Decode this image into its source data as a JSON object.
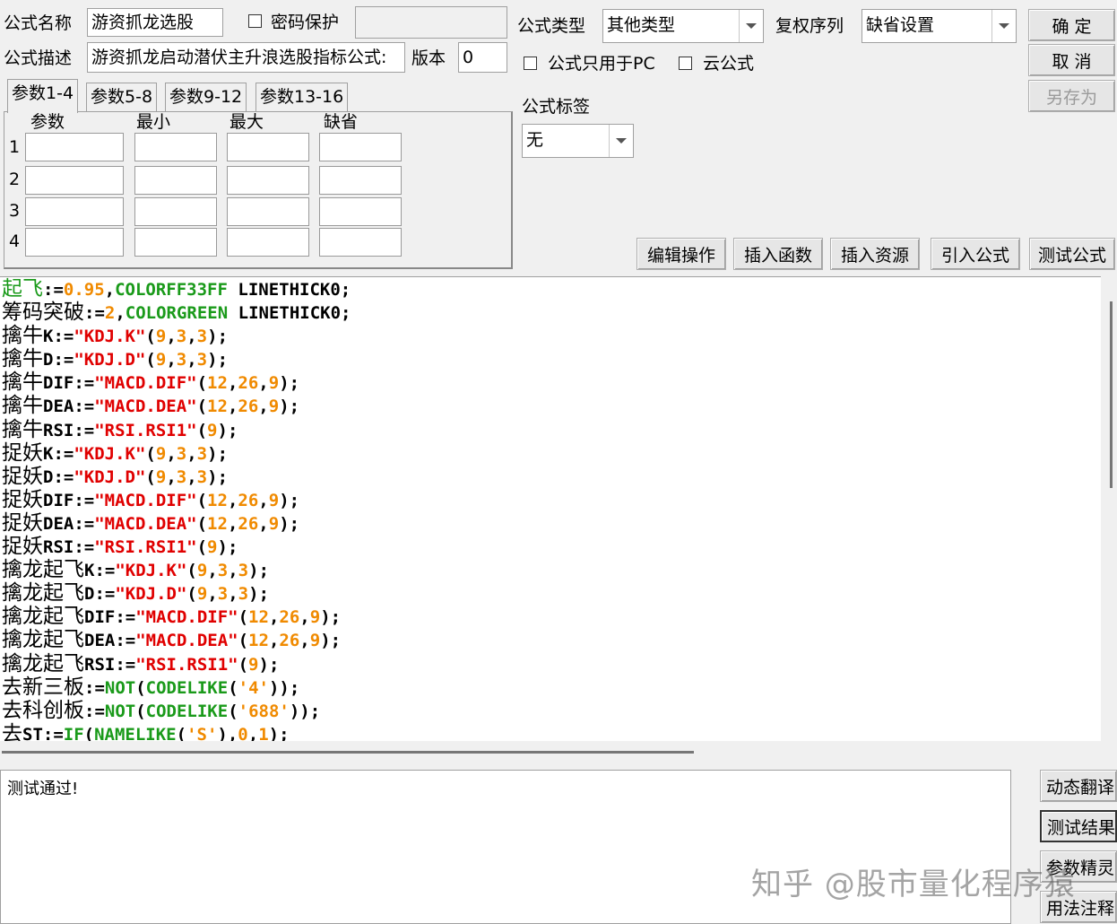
{
  "header": {
    "name_label": "公式名称",
    "name_value": "游资抓龙选股",
    "pwd_label": "密码保护",
    "desc_label": "公式描述",
    "desc_value": "游资抓龙启动潜伏主升浪选股指标公式:",
    "version_label": "版本",
    "version_value": "0",
    "type_label": "公式类型",
    "type_value": "其他类型",
    "fuquan_label": "复权序列",
    "fuquan_value": "缺省设置",
    "pc_only_label": "公式只用于PC",
    "cloud_label": "云公式",
    "tag_label": "公式标签",
    "tag_value": "无"
  },
  "buttons": {
    "ok": "确  定",
    "cancel": "取  消",
    "save_as": "另存为",
    "edit_ops": "编辑操作",
    "insert_func": "插入函数",
    "insert_res": "插入资源",
    "import_formula": "引入公式",
    "test_formula": "测试公式",
    "dyn_translate": "动态翻译",
    "test_result": "测试结果",
    "param_wizard": "参数精灵",
    "usage_notes": "用法注释"
  },
  "params": {
    "tabs": [
      "参数1-4",
      "参数5-8",
      "参数9-12",
      "参数13-16"
    ],
    "headers": [
      "参数",
      "最小",
      "最大",
      "缺省"
    ],
    "rows": [
      "1",
      "2",
      "3",
      "4"
    ]
  },
  "colors": {
    "green": "#1a9a1a",
    "orange": "#f08a00",
    "red": "#e00000",
    "cyan": "#008a8a"
  },
  "code_lines": [
    [
      {
        "t": "起飞",
        "c": "green",
        "cn": true
      },
      {
        "t": ":=",
        "c": "black"
      },
      {
        "t": "0.95",
        "c": "orange"
      },
      {
        "t": ",",
        "c": "black"
      },
      {
        "t": "COLORFF33FF",
        "c": "green"
      },
      {
        "t": " LINETHICK0;",
        "c": "black"
      }
    ],
    [
      {
        "t": "筹码突破",
        "c": "black",
        "cn": true
      },
      {
        "t": ":=",
        "c": "black"
      },
      {
        "t": "2",
        "c": "orange"
      },
      {
        "t": ",",
        "c": "black"
      },
      {
        "t": "COLORGREEN",
        "c": "green"
      },
      {
        "t": " LINETHICK0;",
        "c": "black"
      }
    ],
    [
      {
        "t": "擒牛",
        "c": "black",
        "cn": true
      },
      {
        "t": "K:=",
        "c": "black"
      },
      {
        "t": "\"KDJ.K\"",
        "c": "red"
      },
      {
        "t": "(",
        "c": "black"
      },
      {
        "t": "9",
        "c": "orange"
      },
      {
        "t": ",",
        "c": "black"
      },
      {
        "t": "3",
        "c": "orange"
      },
      {
        "t": ",",
        "c": "black"
      },
      {
        "t": "3",
        "c": "orange"
      },
      {
        "t": ");",
        "c": "black"
      }
    ],
    [
      {
        "t": "擒牛",
        "c": "black",
        "cn": true
      },
      {
        "t": "D:=",
        "c": "black"
      },
      {
        "t": "\"KDJ.D\"",
        "c": "red"
      },
      {
        "t": "(",
        "c": "black"
      },
      {
        "t": "9",
        "c": "orange"
      },
      {
        "t": ",",
        "c": "black"
      },
      {
        "t": "3",
        "c": "orange"
      },
      {
        "t": ",",
        "c": "black"
      },
      {
        "t": "3",
        "c": "orange"
      },
      {
        "t": ");",
        "c": "black"
      }
    ],
    [
      {
        "t": "擒牛",
        "c": "black",
        "cn": true
      },
      {
        "t": "DIF:=",
        "c": "black"
      },
      {
        "t": "\"MACD.DIF\"",
        "c": "red"
      },
      {
        "t": "(",
        "c": "black"
      },
      {
        "t": "12",
        "c": "orange"
      },
      {
        "t": ",",
        "c": "black"
      },
      {
        "t": "26",
        "c": "orange"
      },
      {
        "t": ",",
        "c": "black"
      },
      {
        "t": "9",
        "c": "orange"
      },
      {
        "t": ");",
        "c": "black"
      }
    ],
    [
      {
        "t": "擒牛",
        "c": "black",
        "cn": true
      },
      {
        "t": "DEA:=",
        "c": "black"
      },
      {
        "t": "\"MACD.DEA\"",
        "c": "red"
      },
      {
        "t": "(",
        "c": "black"
      },
      {
        "t": "12",
        "c": "orange"
      },
      {
        "t": ",",
        "c": "black"
      },
      {
        "t": "26",
        "c": "orange"
      },
      {
        "t": ",",
        "c": "black"
      },
      {
        "t": "9",
        "c": "orange"
      },
      {
        "t": ");",
        "c": "black"
      }
    ],
    [
      {
        "t": "擒牛",
        "c": "black",
        "cn": true
      },
      {
        "t": "RSI:=",
        "c": "black"
      },
      {
        "t": "\"RSI.RSI1\"",
        "c": "red"
      },
      {
        "t": "(",
        "c": "black"
      },
      {
        "t": "9",
        "c": "orange"
      },
      {
        "t": ");",
        "c": "black"
      }
    ],
    [
      {
        "t": "捉妖",
        "c": "black",
        "cn": true
      },
      {
        "t": "K:=",
        "c": "black"
      },
      {
        "t": "\"KDJ.K\"",
        "c": "red"
      },
      {
        "t": "(",
        "c": "black"
      },
      {
        "t": "9",
        "c": "orange"
      },
      {
        "t": ",",
        "c": "black"
      },
      {
        "t": "3",
        "c": "orange"
      },
      {
        "t": ",",
        "c": "black"
      },
      {
        "t": "3",
        "c": "orange"
      },
      {
        "t": ");",
        "c": "black"
      }
    ],
    [
      {
        "t": "捉妖",
        "c": "black",
        "cn": true
      },
      {
        "t": "D:=",
        "c": "black"
      },
      {
        "t": "\"KDJ.D\"",
        "c": "red"
      },
      {
        "t": "(",
        "c": "black"
      },
      {
        "t": "9",
        "c": "orange"
      },
      {
        "t": ",",
        "c": "black"
      },
      {
        "t": "3",
        "c": "orange"
      },
      {
        "t": ",",
        "c": "black"
      },
      {
        "t": "3",
        "c": "orange"
      },
      {
        "t": ");",
        "c": "black"
      }
    ],
    [
      {
        "t": "捉妖",
        "c": "black",
        "cn": true
      },
      {
        "t": "DIF:=",
        "c": "black"
      },
      {
        "t": "\"MACD.DIF\"",
        "c": "red"
      },
      {
        "t": "(",
        "c": "black"
      },
      {
        "t": "12",
        "c": "orange"
      },
      {
        "t": ",",
        "c": "black"
      },
      {
        "t": "26",
        "c": "orange"
      },
      {
        "t": ",",
        "c": "black"
      },
      {
        "t": "9",
        "c": "orange"
      },
      {
        "t": ");",
        "c": "black"
      }
    ],
    [
      {
        "t": "捉妖",
        "c": "black",
        "cn": true
      },
      {
        "t": "DEA:=",
        "c": "black"
      },
      {
        "t": "\"MACD.DEA\"",
        "c": "red"
      },
      {
        "t": "(",
        "c": "black"
      },
      {
        "t": "12",
        "c": "orange"
      },
      {
        "t": ",",
        "c": "black"
      },
      {
        "t": "26",
        "c": "orange"
      },
      {
        "t": ",",
        "c": "black"
      },
      {
        "t": "9",
        "c": "orange"
      },
      {
        "t": ");",
        "c": "black"
      }
    ],
    [
      {
        "t": "捉妖",
        "c": "black",
        "cn": true
      },
      {
        "t": "RSI:=",
        "c": "black"
      },
      {
        "t": "\"RSI.RSI1\"",
        "c": "red"
      },
      {
        "t": "(",
        "c": "black"
      },
      {
        "t": "9",
        "c": "orange"
      },
      {
        "t": ");",
        "c": "black"
      }
    ],
    [
      {
        "t": "擒龙起飞",
        "c": "black",
        "cn": true
      },
      {
        "t": "K:=",
        "c": "black"
      },
      {
        "t": "\"KDJ.K\"",
        "c": "red"
      },
      {
        "t": "(",
        "c": "black"
      },
      {
        "t": "9",
        "c": "orange"
      },
      {
        "t": ",",
        "c": "black"
      },
      {
        "t": "3",
        "c": "orange"
      },
      {
        "t": ",",
        "c": "black"
      },
      {
        "t": "3",
        "c": "orange"
      },
      {
        "t": ");",
        "c": "black"
      }
    ],
    [
      {
        "t": "擒龙起飞",
        "c": "black",
        "cn": true
      },
      {
        "t": "D:=",
        "c": "black"
      },
      {
        "t": "\"KDJ.D\"",
        "c": "red"
      },
      {
        "t": "(",
        "c": "black"
      },
      {
        "t": "9",
        "c": "orange"
      },
      {
        "t": ",",
        "c": "black"
      },
      {
        "t": "3",
        "c": "orange"
      },
      {
        "t": ",",
        "c": "black"
      },
      {
        "t": "3",
        "c": "orange"
      },
      {
        "t": ");",
        "c": "black"
      }
    ],
    [
      {
        "t": "擒龙起飞",
        "c": "black",
        "cn": true
      },
      {
        "t": "DIF:=",
        "c": "black"
      },
      {
        "t": "\"MACD.DIF\"",
        "c": "red"
      },
      {
        "t": "(",
        "c": "black"
      },
      {
        "t": "12",
        "c": "orange"
      },
      {
        "t": ",",
        "c": "black"
      },
      {
        "t": "26",
        "c": "orange"
      },
      {
        "t": ",",
        "c": "black"
      },
      {
        "t": "9",
        "c": "orange"
      },
      {
        "t": ");",
        "c": "black"
      }
    ],
    [
      {
        "t": "擒龙起飞",
        "c": "black",
        "cn": true
      },
      {
        "t": "DEA:=",
        "c": "black"
      },
      {
        "t": "\"MACD.DEA\"",
        "c": "red"
      },
      {
        "t": "(",
        "c": "black"
      },
      {
        "t": "12",
        "c": "orange"
      },
      {
        "t": ",",
        "c": "black"
      },
      {
        "t": "26",
        "c": "orange"
      },
      {
        "t": ",",
        "c": "black"
      },
      {
        "t": "9",
        "c": "orange"
      },
      {
        "t": ");",
        "c": "black"
      }
    ],
    [
      {
        "t": "擒龙起飞",
        "c": "black",
        "cn": true
      },
      {
        "t": "RSI:=",
        "c": "black"
      },
      {
        "t": "\"RSI.RSI1\"",
        "c": "red"
      },
      {
        "t": "(",
        "c": "black"
      },
      {
        "t": "9",
        "c": "orange"
      },
      {
        "t": ");",
        "c": "black"
      }
    ],
    [
      {
        "t": "去新三板",
        "c": "black",
        "cn": true
      },
      {
        "t": ":=",
        "c": "black"
      },
      {
        "t": "NOT",
        "c": "green"
      },
      {
        "t": "(",
        "c": "black"
      },
      {
        "t": "CODELIKE",
        "c": "green"
      },
      {
        "t": "(",
        "c": "black"
      },
      {
        "t": "'4'",
        "c": "orange"
      },
      {
        "t": "));",
        "c": "black"
      }
    ],
    [
      {
        "t": "去科创板",
        "c": "black",
        "cn": true
      },
      {
        "t": ":=",
        "c": "black"
      },
      {
        "t": "NOT",
        "c": "green"
      },
      {
        "t": "(",
        "c": "black"
      },
      {
        "t": "CODELIKE",
        "c": "green"
      },
      {
        "t": "(",
        "c": "black"
      },
      {
        "t": "'688'",
        "c": "orange"
      },
      {
        "t": "));",
        "c": "black"
      }
    ],
    [
      {
        "t": "去",
        "c": "black",
        "cn": true
      },
      {
        "t": "ST:=",
        "c": "black"
      },
      {
        "t": "IF",
        "c": "green"
      },
      {
        "t": "(",
        "c": "black"
      },
      {
        "t": "NAMELIKE",
        "c": "green"
      },
      {
        "t": "(",
        "c": "black"
      },
      {
        "t": "'S'",
        "c": "orange"
      },
      {
        "t": "),",
        "c": "black"
      },
      {
        "t": "0",
        "c": "orange"
      },
      {
        "t": ",",
        "c": "black"
      },
      {
        "t": "1",
        "c": "orange"
      },
      {
        "t": ");",
        "c": "black"
      }
    ]
  ],
  "output": {
    "message": "测试通过!"
  },
  "watermark": "知乎 @股市量化程序猿"
}
